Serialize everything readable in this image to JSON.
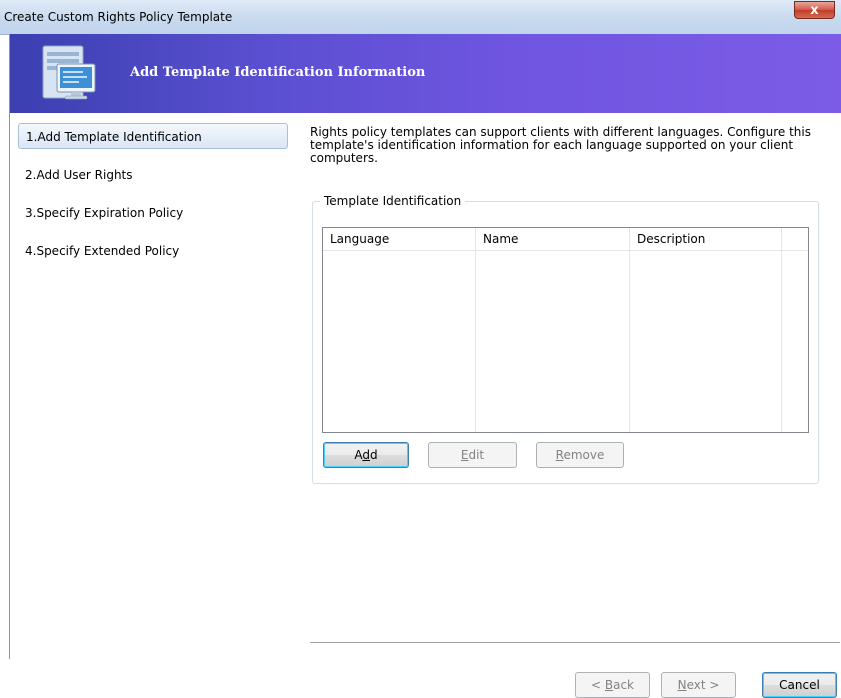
{
  "window": {
    "title": "Create Custom Rights Policy Template",
    "close_glyph": "x"
  },
  "banner": {
    "title": "Add Template Identification Information",
    "icon": "wizard-computer-icon"
  },
  "steps": [
    {
      "label": "1.Add Template Identification",
      "active": true
    },
    {
      "label": "2.Add User Rights",
      "active": false
    },
    {
      "label": "3.Specify Expiration Policy",
      "active": false
    },
    {
      "label": "4.Specify Extended Policy",
      "active": false
    }
  ],
  "main": {
    "description": "Rights policy templates can support clients with different languages. Configure this template's identification information for each language supported on your client computers.",
    "group_title": "Template Identification",
    "columns": [
      "Language",
      "Name",
      "Description"
    ],
    "rows": [],
    "buttons": {
      "add": {
        "pre": "A",
        "key": "d",
        "post": "d"
      },
      "edit": {
        "pre": "",
        "key": "E",
        "post": "dit"
      },
      "remove": {
        "pre": "",
        "key": "R",
        "post": "emove"
      }
    }
  },
  "footer": {
    "back": {
      "pre": "< ",
      "key": "B",
      "post": "ack"
    },
    "next": {
      "pre": "",
      "key": "N",
      "post": "ext >"
    },
    "cancel": "Cancel"
  },
  "colors": {
    "banner_start": "#3b3fb0",
    "banner_end": "#7c5ce6",
    "close_button": "#c33a28"
  }
}
